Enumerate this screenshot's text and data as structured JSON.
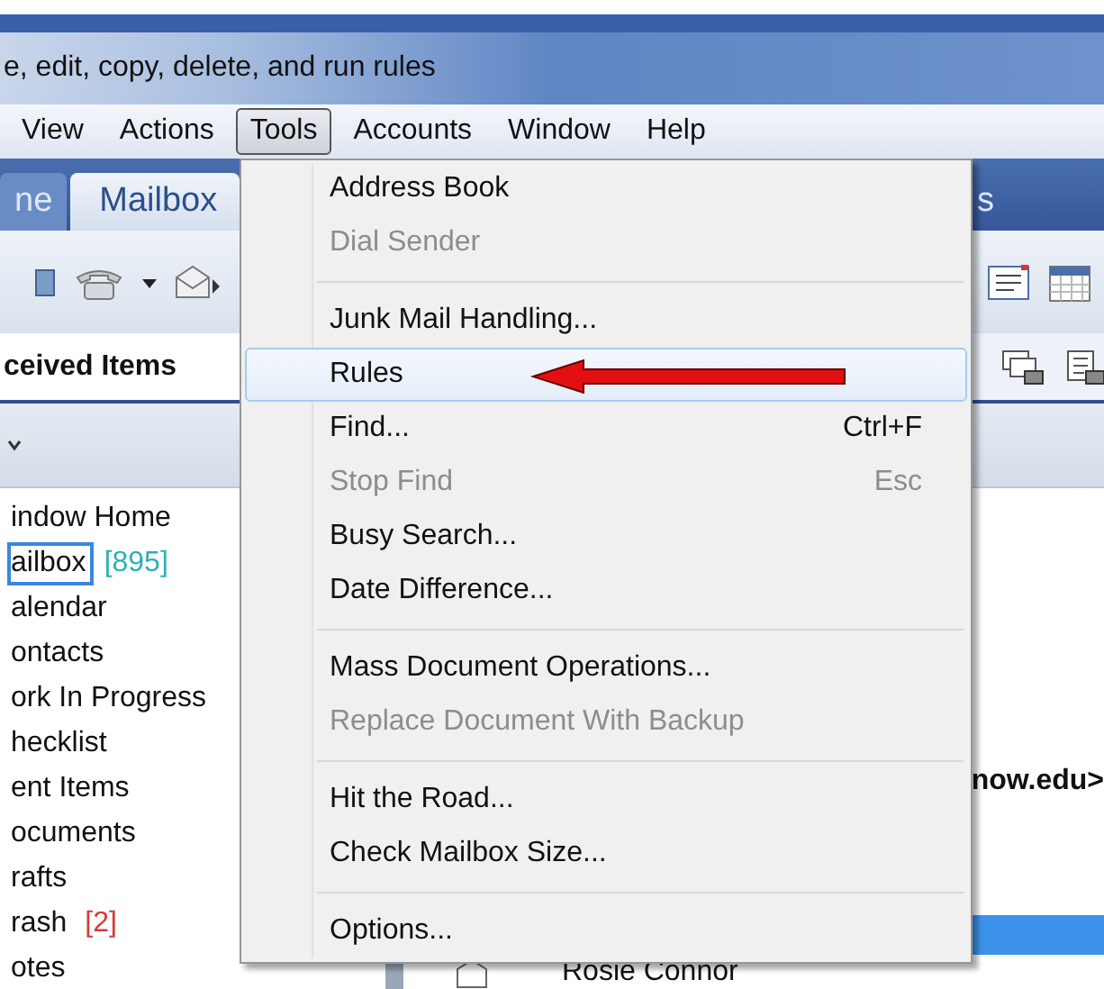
{
  "window": {
    "title": "e, edit, copy, delete, and run rules"
  },
  "menubar": [
    {
      "label": "View",
      "selected": false
    },
    {
      "label": "Actions",
      "selected": false
    },
    {
      "label": "Tools",
      "selected": true
    },
    {
      "label": "Accounts",
      "selected": false
    },
    {
      "label": "Window",
      "selected": false
    },
    {
      "label": "Help",
      "selected": false
    }
  ],
  "tabs": [
    {
      "label": "ne",
      "selected": false
    },
    {
      "label": "Mailbox",
      "selected": true
    },
    {
      "label": "s",
      "selected": false
    }
  ],
  "sidebar": {
    "header": "ceived Items",
    "items": [
      {
        "label": "indow Home",
        "selected": false
      },
      {
        "label": "ailbox",
        "selected": true,
        "count": "[895]",
        "color": "#2bb0b8"
      },
      {
        "label": "alendar",
        "selected": false
      },
      {
        "label": "ontacts",
        "selected": false
      },
      {
        "label": "ork In Progress",
        "selected": false
      },
      {
        "label": "hecklist",
        "selected": false
      },
      {
        "label": "ent Items",
        "selected": false
      },
      {
        "label": "ocuments",
        "selected": false
      },
      {
        "label": "rafts",
        "selected": false
      },
      {
        "label": "rash",
        "selected": false,
        "count": "[2]",
        "color": "#d63a3a"
      },
      {
        "label": "otes",
        "selected": false
      }
    ]
  },
  "message": {
    "address_fragment": "now.edu>",
    "rows": [
      {
        "sender": "",
        "selected": true
      },
      {
        "sender": "Rosie Connor",
        "selected": false
      }
    ]
  },
  "tools_menu": [
    {
      "kind": "item",
      "label": "Address Book",
      "disabled": false,
      "selected": false
    },
    {
      "kind": "item",
      "label": "Dial Sender",
      "disabled": true,
      "selected": false
    },
    {
      "kind": "separator"
    },
    {
      "kind": "item",
      "label": "Junk Mail Handling...",
      "disabled": false,
      "selected": false
    },
    {
      "kind": "item",
      "label": "Rules",
      "disabled": false,
      "selected": true
    },
    {
      "kind": "item",
      "label": "Find...",
      "shortcut": "Ctrl+F",
      "disabled": false,
      "selected": false
    },
    {
      "kind": "item",
      "label": "Stop Find",
      "shortcut": "Esc",
      "disabled": true,
      "selected": false
    },
    {
      "kind": "item",
      "label": "Busy Search...",
      "disabled": false,
      "selected": false
    },
    {
      "kind": "item",
      "label": "Date Difference...",
      "disabled": false,
      "selected": false
    },
    {
      "kind": "separator"
    },
    {
      "kind": "item",
      "label": "Mass Document Operations...",
      "disabled": false,
      "selected": false
    },
    {
      "kind": "item",
      "label": "Replace Document With Backup",
      "disabled": true,
      "selected": false
    },
    {
      "kind": "separator"
    },
    {
      "kind": "item",
      "label": "Hit the Road...",
      "disabled": false,
      "selected": false
    },
    {
      "kind": "item",
      "label": "Check Mailbox Size...",
      "disabled": false,
      "selected": false
    },
    {
      "kind": "separator"
    },
    {
      "kind": "item",
      "label": "Options...",
      "disabled": false,
      "selected": false
    }
  ]
}
